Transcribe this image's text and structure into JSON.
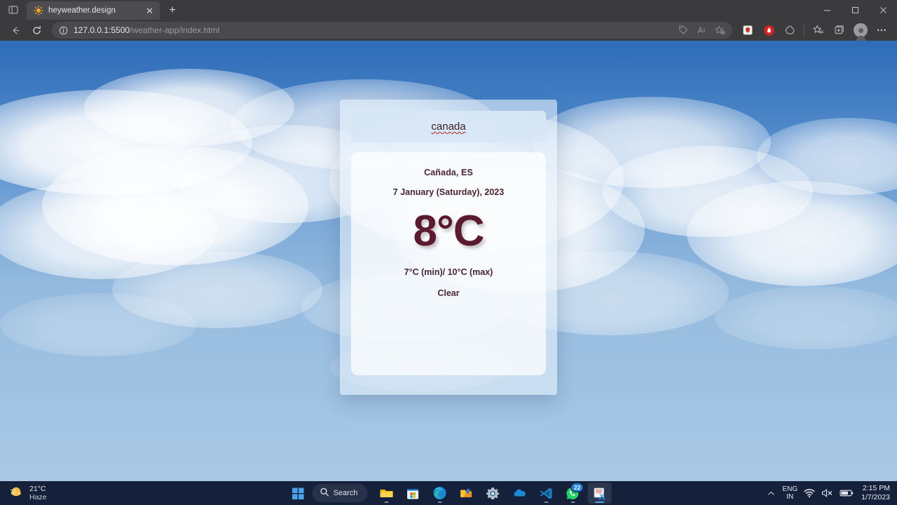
{
  "browser": {
    "tab": {
      "title": "heyweather.design",
      "favicon_icon": "sun-icon",
      "close_icon": "close-icon"
    },
    "sidebar_icon": "sidebar-toggle-icon",
    "new_tab_icon": "plus-icon",
    "window_controls": {
      "minimize": "—",
      "maximize": "☐",
      "close": "✕"
    },
    "nav": {
      "back_icon": "back-arrow-icon",
      "reload_icon": "reload-icon"
    },
    "omnibox": {
      "info_icon": "site-info-icon",
      "url_host": "127.0.0.1:5500",
      "url_path": "/weather-app/index.html",
      "price_icon": "shopping-tag-icon",
      "read_aloud_icon": "read-aloud-icon",
      "favorite_icon": "add-favorite-icon"
    },
    "toolbar_icons": [
      "shield-extension-icon",
      "adblock-extension-icon",
      "browser-essentials-icon",
      "favorites-icon",
      "collections-icon",
      "profile-avatar-icon",
      "settings-more-icon"
    ]
  },
  "weather_app": {
    "search": {
      "value": "canada",
      "spellcheck_color": "#b22222"
    },
    "location": "Cañada, ES",
    "date": "7 January (Saturday), 2023",
    "temperature": "8°C",
    "minmax": "7°C (min)/ 10°C (max)",
    "condition": "Clear",
    "text_color": "#4a2430",
    "temp_color": "#5c1a2e"
  },
  "taskbar": {
    "weather_widget": {
      "icon": "haze-sun-icon",
      "temp": "21°C",
      "condition": "Haze"
    },
    "start_icon": "windows-start-icon",
    "search": {
      "icon": "search-icon",
      "label": "Search"
    },
    "apps": [
      {
        "name": "file-explorer",
        "icon": "folder-icon",
        "running": true
      },
      {
        "name": "microsoft-store",
        "icon": "store-icon",
        "running": false
      },
      {
        "name": "microsoft-edge",
        "icon": "edge-icon",
        "running": true
      },
      {
        "name": "notes-app",
        "icon": "notes-icon",
        "running": false
      },
      {
        "name": "settings",
        "icon": "gear-icon",
        "running": false
      },
      {
        "name": "onedrive",
        "icon": "cloud-icon",
        "running": false
      },
      {
        "name": "visual-studio-code",
        "icon": "vscode-icon",
        "running": true
      },
      {
        "name": "whatsapp",
        "icon": "whatsapp-icon",
        "running": true,
        "badge": "22"
      },
      {
        "name": "snipping-tool",
        "icon": "snipping-tool-icon",
        "running": true,
        "active": true
      }
    ],
    "tray": {
      "chevron_icon": "chevron-up-icon",
      "language": {
        "line1": "ENG",
        "line2": "IN"
      },
      "wifi_icon": "wifi-icon",
      "volume_icon": "volume-muted-icon",
      "battery_icon": "battery-icon",
      "time": "2:15 PM",
      "date": "1/7/2023"
    }
  }
}
